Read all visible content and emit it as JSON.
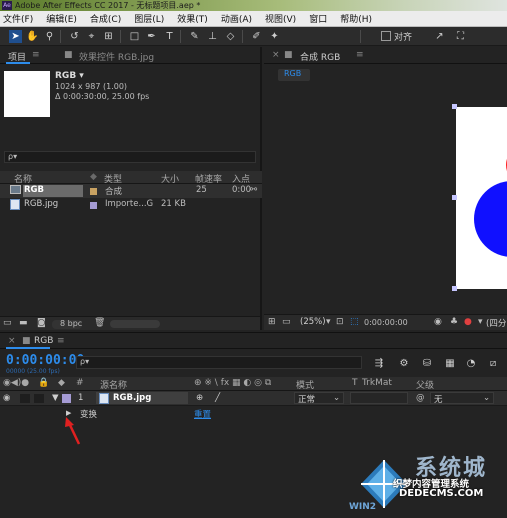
{
  "window": {
    "title": "Adobe After Effects CC 2017 - 无标题项目.aep *",
    "app_badge": "Ae"
  },
  "menu": {
    "items": [
      "文件(F)",
      "编辑(E)",
      "合成(C)",
      "图层(L)",
      "效果(T)",
      "动画(A)",
      "视图(V)",
      "窗口",
      "帮助(H)"
    ]
  },
  "toolbar": {
    "snap_label": "对齐"
  },
  "project_panel": {
    "tab_label": "项目",
    "effects_tab_label": "效果控件 RGB.jpg",
    "selected_name": "RGB ▾",
    "selected_dims": "1024 x 987 (1.00)",
    "selected_duration": "Δ 0:00:30:00, 25.00 fps",
    "search_placeholder": "ρ▾",
    "columns": [
      "名称",
      "类型",
      "大小",
      "帧速率",
      "入点"
    ],
    "rows": [
      {
        "name": "RGB",
        "type": "合成",
        "size": "",
        "fps": "25",
        "in": "0:00",
        "swatch": "#c8a262"
      },
      {
        "name": "RGB.jpg",
        "type": "Importe...G",
        "size": "21 KB",
        "fps": "",
        "in": "",
        "swatch": "#a59bd4"
      }
    ],
    "bpc_label": "8 bpc"
  },
  "viewer": {
    "tab_label": "合成 RGB",
    "comp_chip": "RGB",
    "zoom": "(25%)",
    "timecode": "0:00:00:00",
    "quality": "(四分"
  },
  "timeline": {
    "tab_label": "RGB",
    "timecode": "0:00:00:00",
    "timecode_sub": "00000 (25.00 fps)",
    "search_placeholder": "ρ▾",
    "columns": {
      "index": "#",
      "source": "源名称",
      "mode": "模式",
      "t": "T",
      "trkmat": "TrkMat",
      "parent": "父级"
    },
    "layer": {
      "index": "1",
      "name": "RGB.jpg",
      "mode": "正常",
      "parent": "无",
      "color": "#a59bd4"
    },
    "transform": {
      "label": "变换",
      "reset": "重置"
    }
  },
  "watermark": {
    "brand": "系统城",
    "site1": "DEDECMS.COM",
    "site2": "WIN2",
    "cn": "织梦内容管理系统"
  },
  "colors": {
    "accent": "#2d8ceb",
    "red_arrow": "#e02020"
  }
}
